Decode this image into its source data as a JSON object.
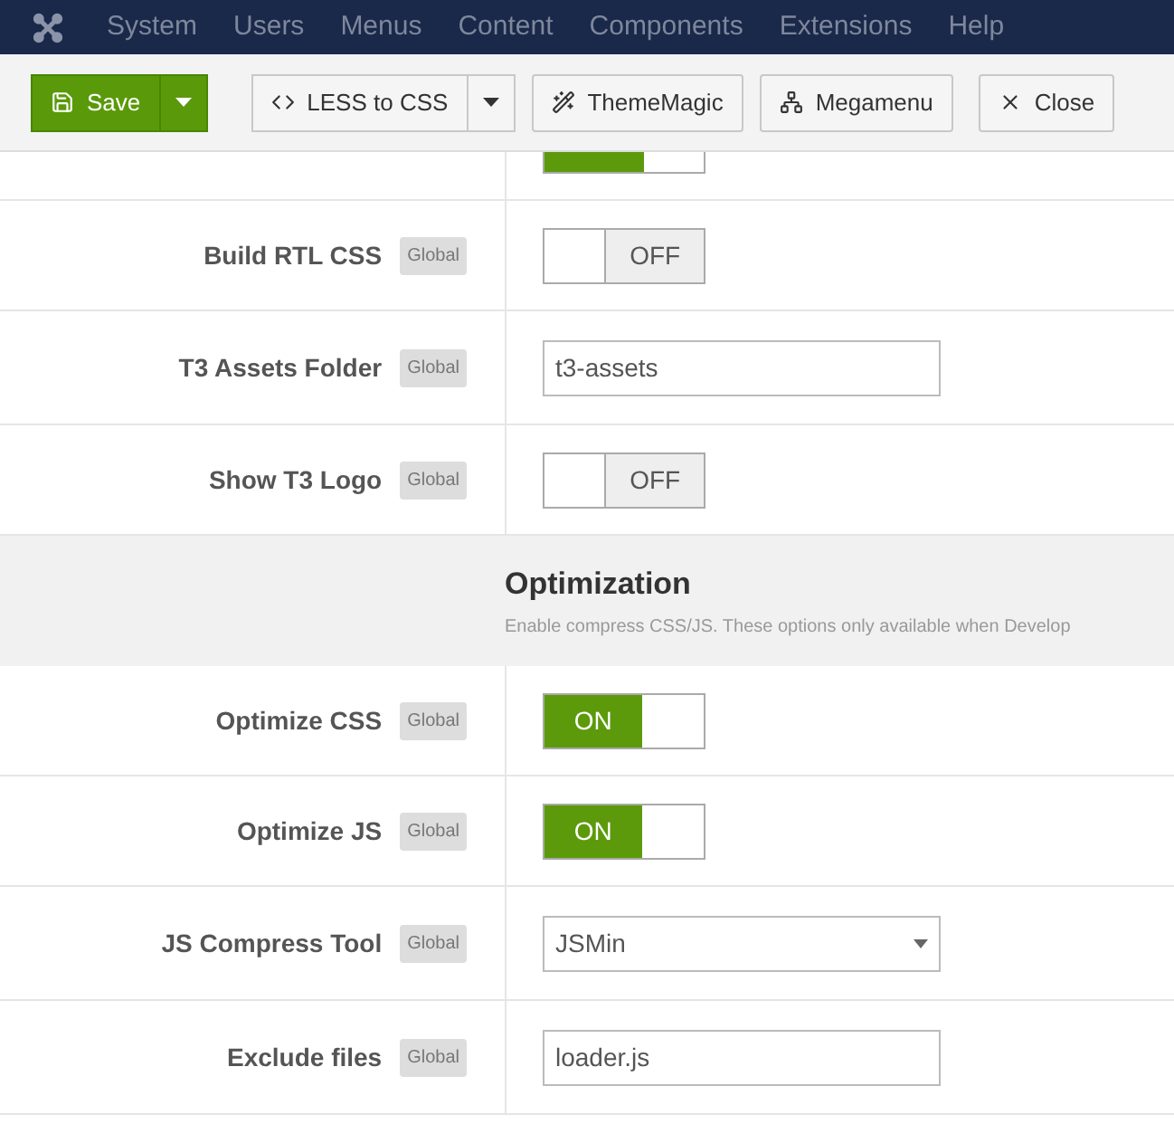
{
  "menu": {
    "items": [
      "System",
      "Users",
      "Menus",
      "Content",
      "Components",
      "Extensions",
      "Help"
    ]
  },
  "toolbar": {
    "buttons": [
      {
        "kind": "primary",
        "label": "Save",
        "split": true
      },
      {
        "kind": "default",
        "label": "LESS to CSS",
        "split": true
      },
      {
        "kind": "default",
        "label": "ThemeMagic",
        "split": false
      },
      {
        "kind": "default",
        "label": "Megamenu",
        "split": false
      },
      {
        "kind": "default",
        "label": "Close",
        "split": false
      }
    ]
  },
  "partial_row": {
    "on": true
  },
  "rows_top": [
    {
      "label": "Build RTL CSS",
      "badge": "Global",
      "kind": "toggle",
      "on": false,
      "text": "OFF"
    },
    {
      "label": "T3 Assets Folder",
      "badge": "Global",
      "kind": "text",
      "value": "t3-assets"
    },
    {
      "label": "Show T3 Logo",
      "badge": "Global",
      "kind": "toggle",
      "on": false,
      "text": "OFF"
    }
  ],
  "section": {
    "title": "Optimization",
    "description": "Enable compress CSS/JS. These options only available when Develop"
  },
  "rows": [
    {
      "label": "Optimize CSS",
      "badge": "Global",
      "kind": "toggle",
      "on": true,
      "text": "ON"
    },
    {
      "label": "Optimize JS",
      "badge": "Global",
      "kind": "toggle",
      "on": true,
      "text": "ON"
    },
    {
      "label": "JS Compress Tool",
      "badge": "Global",
      "kind": "select",
      "value": "JSMin"
    },
    {
      "label": "Exclude files",
      "badge": "Global",
      "kind": "text",
      "value": "loader.js"
    }
  ]
}
